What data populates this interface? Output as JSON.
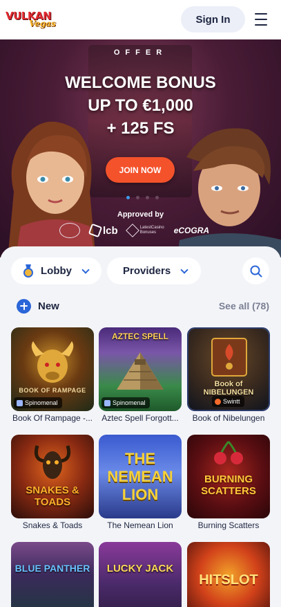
{
  "header": {
    "logo_main": "VULKAN",
    "logo_sub": "Vegas",
    "sign_in_label": "Sign In"
  },
  "hero": {
    "kicker": "OFFER",
    "title_line1": "WELCOME BONUS",
    "title_line2": "UP TO €1,000",
    "title_line3": "+ 125 FS",
    "cta_label": "JOIN NOW",
    "slide_count": 4,
    "active_slide": 1,
    "approved_label": "Approved by",
    "badges": {
      "lcb": "lcb",
      "lcbonus_line1": "LatestCasino",
      "lcbonus_line2": "Bonuses",
      "ecogra": "eCOGRA"
    }
  },
  "filters": {
    "lobby_label": "Lobby",
    "providers_label": "Providers",
    "search_icon": "search-icon"
  },
  "section": {
    "title": "New",
    "see_all": "See all (78)"
  },
  "games": [
    {
      "name": "Book Of Rampage -...",
      "art": "BOOK OF RAMPAGE",
      "provider": "Spinomenal"
    },
    {
      "name": "Aztec Spell Forgott...",
      "art": "AZTEC SPELL",
      "provider": "Spinomenal"
    },
    {
      "name": "Book of Nibelungen",
      "art": "Book of NIBELUNGEN",
      "provider": "Swintt"
    },
    {
      "name": "Snakes & Toads",
      "art": "SNAKES & TOADS",
      "provider": ""
    },
    {
      "name": "The Nemean Lion",
      "art": "THE NEMEAN LION",
      "provider": ""
    },
    {
      "name": "Burning Scatters",
      "art": "BURNING SCATTERS",
      "provider": ""
    },
    {
      "name": "",
      "art": "BLUE PANTHER",
      "provider": ""
    },
    {
      "name": "",
      "art": "LUCKY JACK",
      "provider": ""
    },
    {
      "name": "",
      "art": "HITSLOT",
      "provider": ""
    }
  ],
  "colors": {
    "accent": "#2b66d8",
    "cta": "#f4522b",
    "text": "#1d2540",
    "muted": "#7a8094"
  }
}
